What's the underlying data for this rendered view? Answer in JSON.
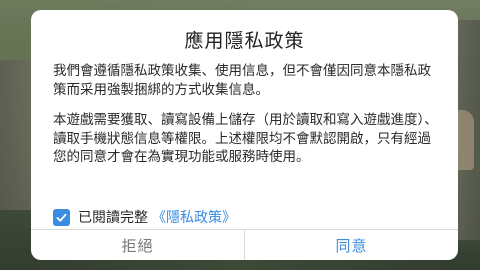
{
  "dialog": {
    "title": "應用隱私政策",
    "paragraph1": "我們會遵循隱私政策收集、使用信息，但不會僅因同意本隱私政策而采用強製捆綁的方式收集信息。",
    "paragraph2": "本遊戲需要獲取、讀寫設備上儲存（用於讀取和寫入遊戲進度）、讀取手機狀態信息等權限。上述權限均不會默認開啟，只有經過您的同意才會在為實現功能或服務時使用。",
    "agree_label": "已閱讀完整",
    "policy_link": "《隱私政策》",
    "agree_checked": true,
    "reject_label": "拒絕",
    "accept_label": "同意"
  },
  "colors": {
    "accent": "#3b8de0",
    "reject_text": "#777777"
  },
  "icons": {
    "checkbox": "check-icon"
  }
}
